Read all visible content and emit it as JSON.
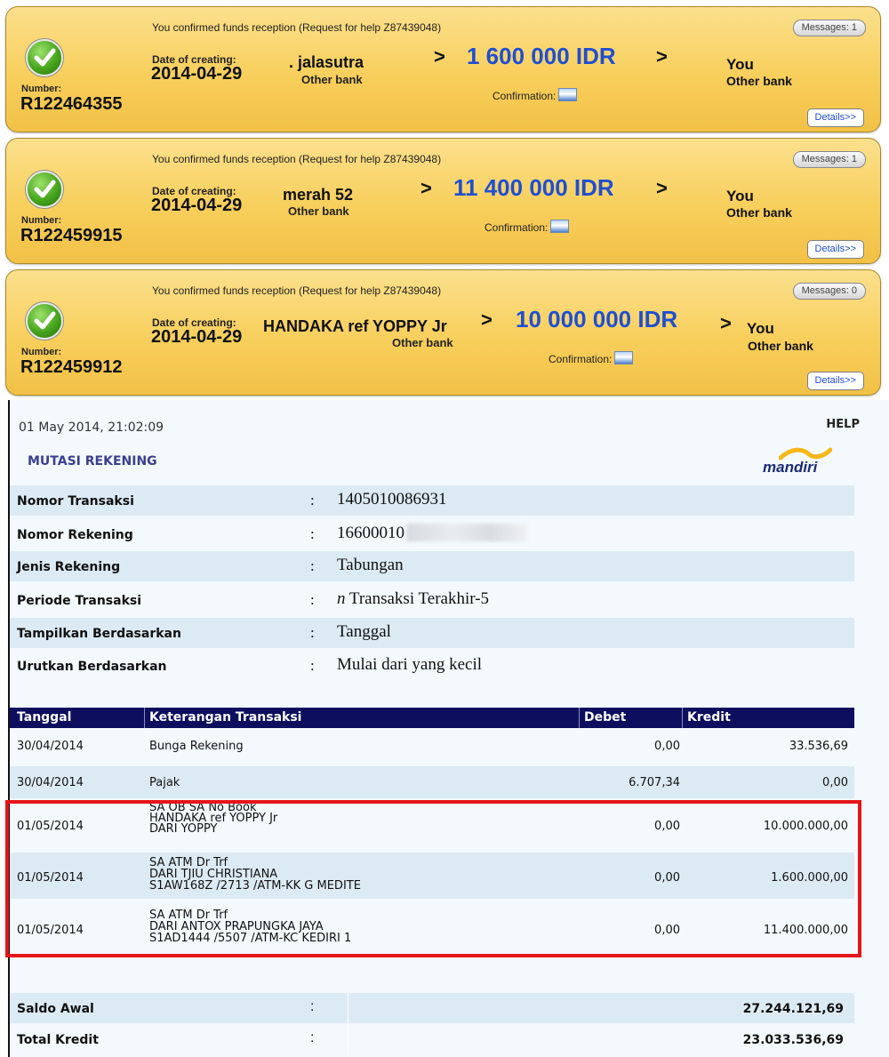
{
  "cards": [
    {
      "status": "You confirmed funds reception (Request for help Z87439048)",
      "messages": "Messages: 1",
      "number_label": "Number:",
      "number": "R122464355",
      "date_label": "Date of creating:",
      "date": "2014-04-29",
      "sender": ". jalasutra",
      "sender_bank": "Other bank",
      "amount": "1 600 000 IDR",
      "confirmation_label": "Confirmation:",
      "recipient": "You",
      "recipient_bank": "Other bank",
      "details_label": "Details>>"
    },
    {
      "status": "You confirmed funds reception (Request for help Z87439048)",
      "messages": "Messages: 1",
      "number_label": "Number:",
      "number": "R122459915",
      "date_label": "Date of creating:",
      "date": "2014-04-29",
      "sender": "merah 52",
      "sender_bank": "Other bank",
      "amount": "11 400 000 IDR",
      "confirmation_label": "Confirmation:",
      "recipient": "You",
      "recipient_bank": "Other bank",
      "details_label": "Details>>"
    },
    {
      "status": "You confirmed funds reception (Request for help Z87439048)",
      "messages": "Messages: 0",
      "number_label": "Number:",
      "number": "R122459912",
      "date_label": "Date of creating:",
      "date": "2014-04-29",
      "sender": "HANDAKA ref YOPPY Jr",
      "sender_bank": "Other bank",
      "amount": "10 000 000 IDR",
      "confirmation_label": "Confirmation:",
      "recipient": "You",
      "recipient_bank": "Other bank",
      "details_label": "Details>>"
    }
  ],
  "arrow_symbol": ">",
  "statement": {
    "datetime": "01 May 2014, 21:02:09",
    "help": "HELP",
    "title": "MUTASI REKENING",
    "logo_text": "mandiri",
    "info": [
      {
        "label": "Nomor Transaksi",
        "value": "1405010086931"
      },
      {
        "label": "Nomor Rekening",
        "value": "16600010"
      },
      {
        "label": "Jenis Rekening",
        "value": "Tabungan"
      },
      {
        "label": "Periode Transaksi",
        "value_italic": "n",
        "value": " Transaksi Terakhir-5"
      },
      {
        "label": "Tampilkan Berdasarkan",
        "value": "Tanggal"
      },
      {
        "label": "Urutkan Berdasarkan",
        "value": "Mulai dari yang kecil"
      }
    ],
    "colon": ":",
    "columns": [
      "Tanggal",
      "Keterangan Transaksi",
      "Debet",
      "Kredit"
    ],
    "transactions": [
      {
        "date": "30/04/2014",
        "desc": [
          "Bunga Rekening"
        ],
        "debet": "0,00",
        "kredit": "33.536,69"
      },
      {
        "date": "30/04/2014",
        "desc": [
          "Pajak"
        ],
        "debet": "6.707,34",
        "kredit": "0,00"
      },
      {
        "date": "01/05/2014",
        "desc": [
          "SA OB SA No Book",
          "HANDAKA ref YOPPY Jr",
          "DARI YOPPY"
        ],
        "debet": "0,00",
        "kredit": "10.000.000,00"
      },
      {
        "date": "01/05/2014",
        "desc": [
          "SA ATM Dr Trf",
          "DARI TJIU CHRISTIANA",
          "S1AW168Z /2713 /ATM-KK G MEDITE"
        ],
        "debet": "0,00",
        "kredit": "1.600.000,00"
      },
      {
        "date": "01/05/2014",
        "desc": [
          "SA ATM Dr Trf",
          "DARI ANTOX PRAPUNGKA JAYA",
          "S1AD1444 /5507 /ATM-KC KEDIRI 1"
        ],
        "debet": "0,00",
        "kredit": "11.400.000,00"
      }
    ],
    "summary": [
      {
        "label": "Saldo Awal",
        "value": "27.244.121,69"
      },
      {
        "label": "Total Kredit",
        "value": "23.033.536,69"
      }
    ]
  },
  "colors": {
    "card_gradient_top": "#fbe08d",
    "card_gradient_bottom": "#f2c146",
    "amount_blue": "#1f4fd1",
    "table_header": "#0d0f5e",
    "row_shade": "#dceaf4",
    "highlight_red": "#e5151a",
    "title_purple": "#3a3f8f"
  },
  "icons": {
    "check": "green-checkmark-icon",
    "confirmation": "image-thumbnail-icon"
  }
}
